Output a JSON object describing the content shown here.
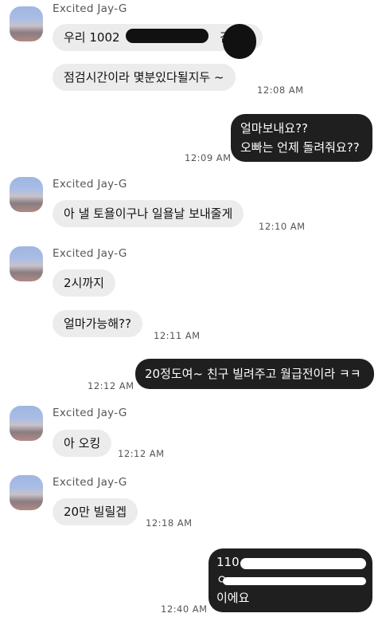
{
  "sender_name": "Excited Jay-G",
  "messages": {
    "m1": "우리 1002",
    "m1_tail": "김",
    "m2": "점검시간이라 몇분있다될지두 ~",
    "t1": "12:08 AM",
    "me1_line1": "얼마보내요??",
    "me1_line2": "오빠는 언제 돌려줘요??",
    "t2": "12:09 AM",
    "m3": "아 낼 토욜이구나 일욜날 보내줄게",
    "t3": "12:10 AM",
    "m4": "2시까지",
    "m5": "얼마가능해??",
    "t4": "12:11 AM",
    "me2": "20정도여~ 친구 빌려주고 월급전이라 ㅋㅋ",
    "t5": "12:12 AM",
    "m6": "아 오킹",
    "t6": "12:12 AM",
    "m7": "20만 빌릴겝",
    "t7": "12:18 AM",
    "me3_line1": "110",
    "me3_line2": "ㅇ.",
    "me3_line3": "이에요",
    "t8": "12:40 AM"
  }
}
